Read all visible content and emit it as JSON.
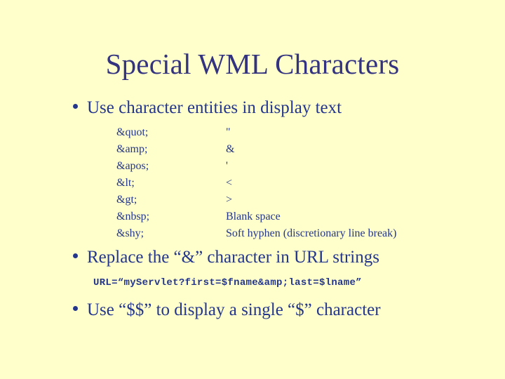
{
  "slide": {
    "background_color": "#ffffcc",
    "title_color": "#333380",
    "body_color": "#24368c",
    "title": "Special WML Characters"
  },
  "bullets": [
    {
      "text": "Use character entities in display text"
    },
    {
      "text": "Replace the “&” character in URL strings"
    },
    {
      "text": "Use “$$” to display a single “$” character"
    }
  ],
  "entity_table": {
    "rows": [
      {
        "entity": "&quot;",
        "character": "\""
      },
      {
        "entity": "&amp;",
        "character": "&"
      },
      {
        "entity": "&apos;",
        "character": "'"
      },
      {
        "entity": "&lt;",
        "character": "<"
      },
      {
        "entity": "&gt;",
        "character": ">"
      },
      {
        "entity": "&nbsp;",
        "character": "Blank space"
      },
      {
        "entity": "&shy;",
        "character": "Soft hyphen (discretionary line break)"
      }
    ]
  },
  "code_example": {
    "text": "URL=“myServlet?first=$fname&amp;last=$lname”"
  }
}
